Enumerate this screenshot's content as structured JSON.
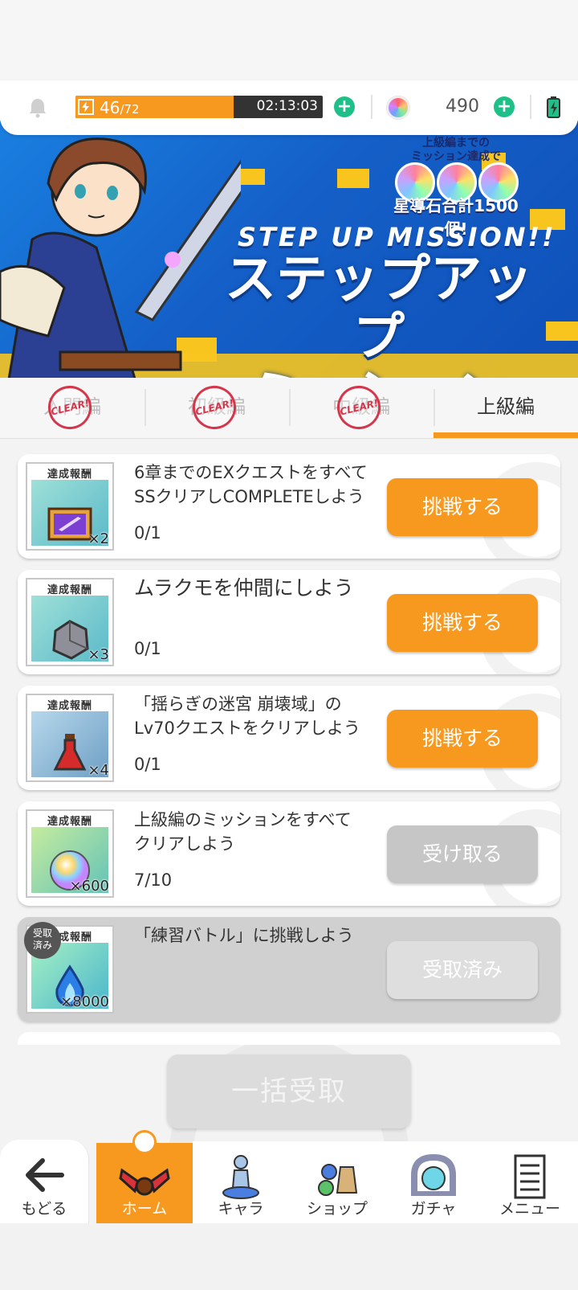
{
  "status": {
    "stamina_current": "46",
    "stamina_max": "/72",
    "stamina_fraction": 0.64,
    "timer": "02:13:03",
    "gem_count": "490",
    "accent_color": "#f8991f",
    "plus_color": "#1fbf88"
  },
  "banner": {
    "prize_line1": "上級編までの",
    "prize_line2": "ミッション達成で",
    "prize_amount": "星導石合計1500個!",
    "subtitle": "STEP UP MISSION!!",
    "title_line1": "ステップアップ",
    "title_line2": "ミッション"
  },
  "tabs": [
    {
      "label": "入門編",
      "stamp": "CLEAR!"
    },
    {
      "label": "初級編",
      "stamp": "CLEAR!"
    },
    {
      "label": "中級編",
      "stamp": "CLEAR!"
    },
    {
      "label": "上級編",
      "stamp": ""
    }
  ],
  "reward_label": "達成報酬",
  "missions": [
    {
      "line1": "6章までのEXクエストをすべて",
      "line2": "SSクリアしCOMPLETEしよう",
      "progress": "0/1",
      "reward_count": "×2",
      "button": "挑戦する",
      "item_icon": "purple-sword-card-icon"
    },
    {
      "line1": "ムラクモを仲間にしよう",
      "line2": "",
      "progress": "0/1",
      "reward_count": "×3",
      "button": "挑戦する",
      "item_icon": "ore-rock-icon"
    },
    {
      "line1": "「揺らぎの迷宮 崩壊域」の",
      "line2": "Lv70クエストをクリアしよう",
      "progress": "0/1",
      "reward_count": "×4",
      "button": "挑戦する",
      "item_icon": "red-potion-icon"
    },
    {
      "line1": "上級編のミッションをすべて",
      "line2": "クリアしよう",
      "progress": "7/10",
      "reward_count": "×600",
      "button": "受け取る",
      "item_icon": "rainbow-gem-icon"
    },
    {
      "line1": "「練習バトル」に挑戦しよう",
      "line2": "",
      "progress": "",
      "reward_count": "×8000",
      "button": "受取済み",
      "item_icon": "blue-flame-icon",
      "badge": "受取済み"
    }
  ],
  "claimed_badge_line1": "受取",
  "claimed_badge_line2": "済み",
  "bulk_claim": "一括受取",
  "nav": [
    {
      "label": "もどる",
      "icon": "back-arrow-icon"
    },
    {
      "label": "ホーム",
      "icon": "home-icon"
    },
    {
      "label": "キャラ",
      "icon": "character-icon"
    },
    {
      "label": "ショップ",
      "icon": "shop-icon"
    },
    {
      "label": "ガチャ",
      "icon": "gacha-icon"
    },
    {
      "label": "メニュー",
      "icon": "menu-list-icon"
    }
  ]
}
